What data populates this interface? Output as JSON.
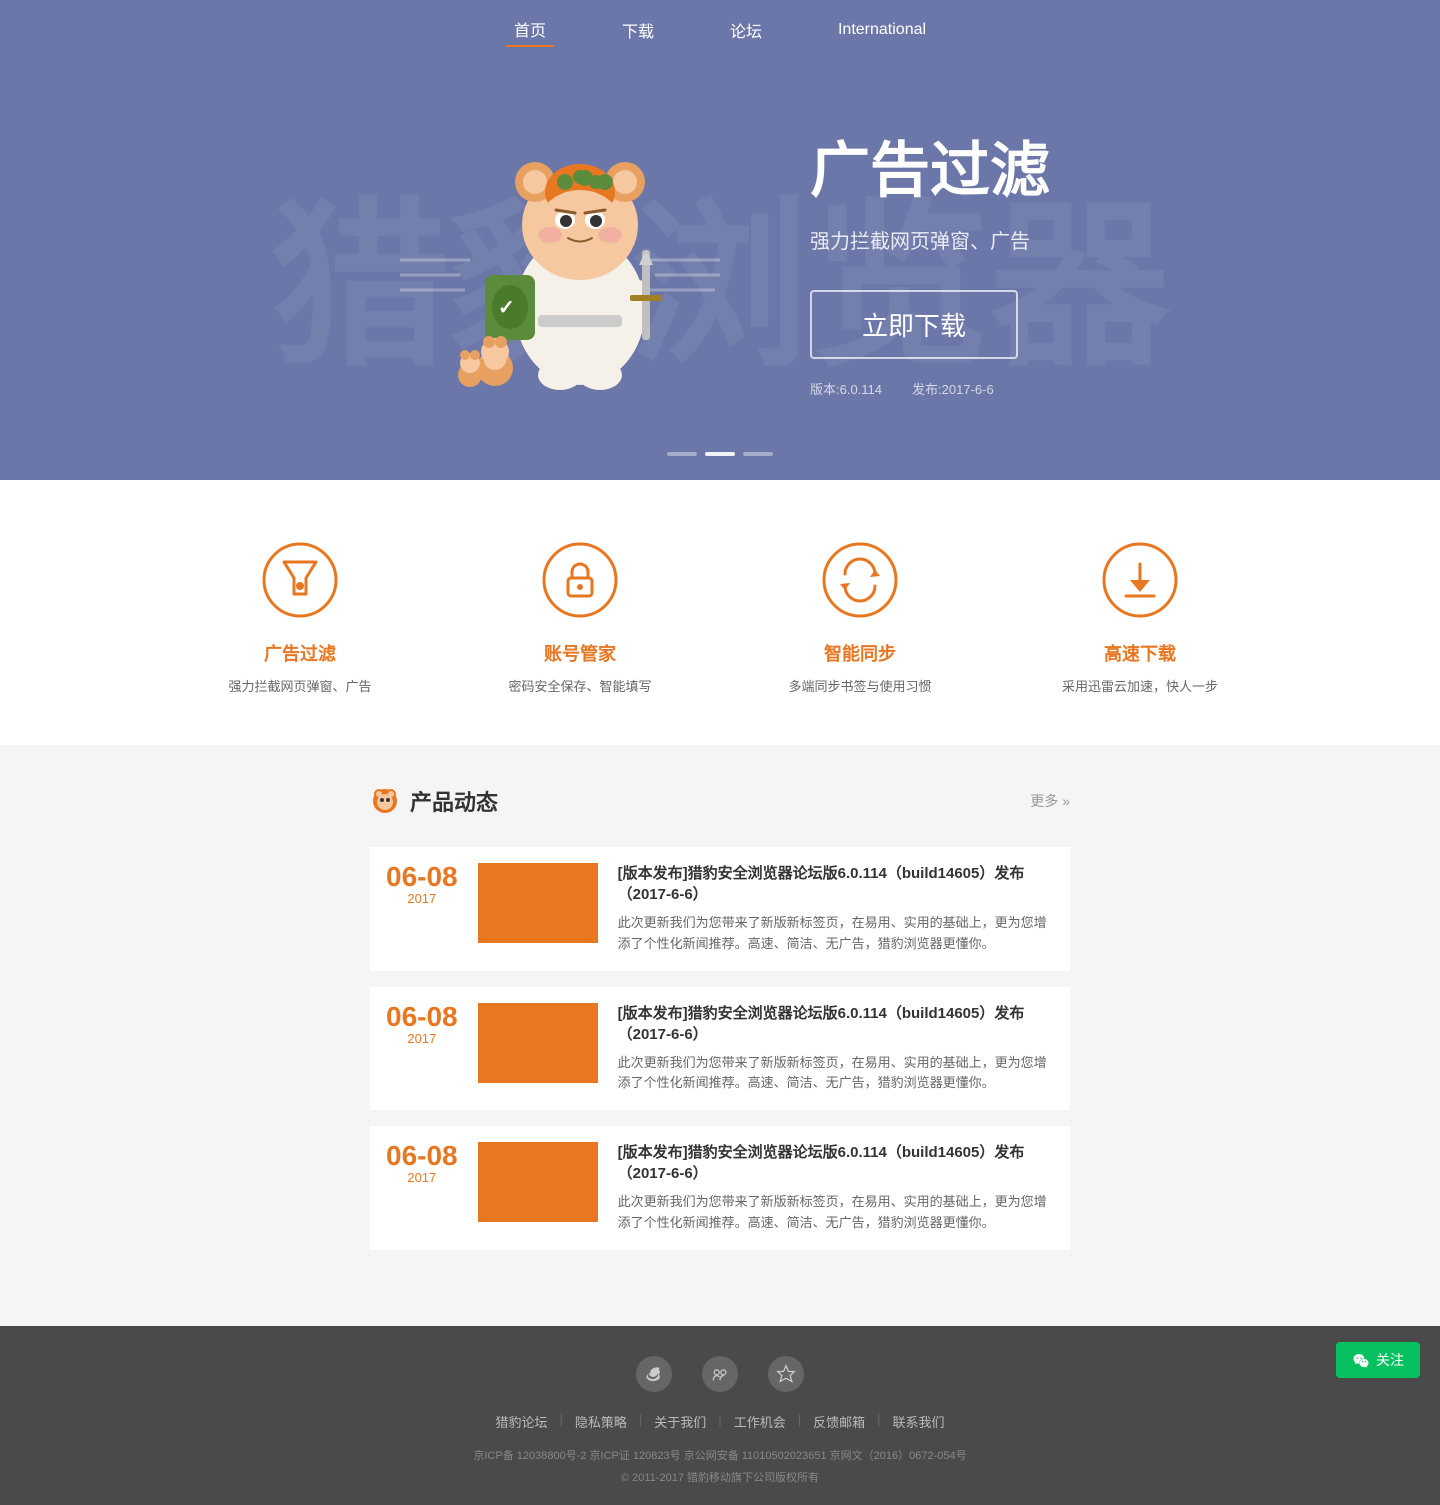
{
  "header": {
    "nav_items": [
      {
        "label": "首页",
        "active": true
      },
      {
        "label": "下载",
        "active": false
      },
      {
        "label": "论坛",
        "active": false
      },
      {
        "label": "International",
        "active": false
      }
    ]
  },
  "hero": {
    "title": "广告过滤",
    "subtitle": "强力拦截网页弹窗、广告",
    "btn_label": "立即下载",
    "version_label": "版本:6.0.114",
    "release_label": "发布:2017-6-6",
    "bg_text": "猎豹浏览器"
  },
  "slider": {
    "dots": [
      {
        "active": false
      },
      {
        "active": true
      },
      {
        "active": false
      }
    ]
  },
  "features": [
    {
      "id": "ad-filter",
      "title": "广告过滤",
      "desc": "强力拦截网页弹窗、广告",
      "icon": "filter"
    },
    {
      "id": "account-manager",
      "title": "账号管家",
      "desc": "密码安全保存、智能填写",
      "icon": "lock-user"
    },
    {
      "id": "smart-sync",
      "title": "智能同步",
      "desc": "多端同步书签与使用习惯",
      "icon": "sync"
    },
    {
      "id": "fast-download",
      "title": "高速下载",
      "desc": "采用迅雷云加速，快人一步",
      "icon": "download"
    }
  ],
  "news": {
    "section_title": "产品动态",
    "more_label": "更多",
    "items": [
      {
        "day": "06-08",
        "year": "2017",
        "title": "[版本发布]猎豹安全浏览器论坛版6.0.114（build14605）发布（2017-6-6）",
        "desc": "此次更新我们为您带来了新版新标签页，在易用、实用的基础上，更为您增添了个性化新闻推荐。高速、简洁、无广告，猎豹浏览器更懂你。"
      },
      {
        "day": "06-08",
        "year": "2017",
        "title": "[版本发布]猎豹安全浏览器论坛版6.0.114（build14605）发布（2017-6-6）",
        "desc": "此次更新我们为您带来了新版新标签页，在易用、实用的基础上，更为您增添了个性化新闻推荐。高速、简洁、无广告，猎豹浏览器更懂你。"
      },
      {
        "day": "06-08",
        "year": "2017",
        "title": "[版本发布]猎豹安全浏览器论坛版6.0.114（build14605）发布（2017-6-6）",
        "desc": "此次更新我们为您带来了新版新标签页，在易用、实用的基础上，更为您增添了个性化新闻推荐。高速、简洁、无广告，猎豹浏览器更懂你。"
      }
    ]
  },
  "footer": {
    "social_icons": [
      {
        "name": "weibo",
        "symbol": "微"
      },
      {
        "name": "renren",
        "symbol": "人"
      },
      {
        "name": "favorite",
        "symbol": "☆"
      }
    ],
    "links": [
      {
        "label": "猎豹论坛"
      },
      {
        "label": "隐私策略"
      },
      {
        "label": "关于我们"
      },
      {
        "label": "工作机会"
      },
      {
        "label": "反馈邮箱"
      },
      {
        "label": "联系我们"
      }
    ],
    "icp": "京ICP备 12038800号-2  京ICP证 120823号  京公网安备 11010502023651  京网文（2016）0672-054号",
    "copyright": "© 2011-2017 猎豹移动旗下公司版权所有"
  },
  "wechat": {
    "label": "关注"
  }
}
